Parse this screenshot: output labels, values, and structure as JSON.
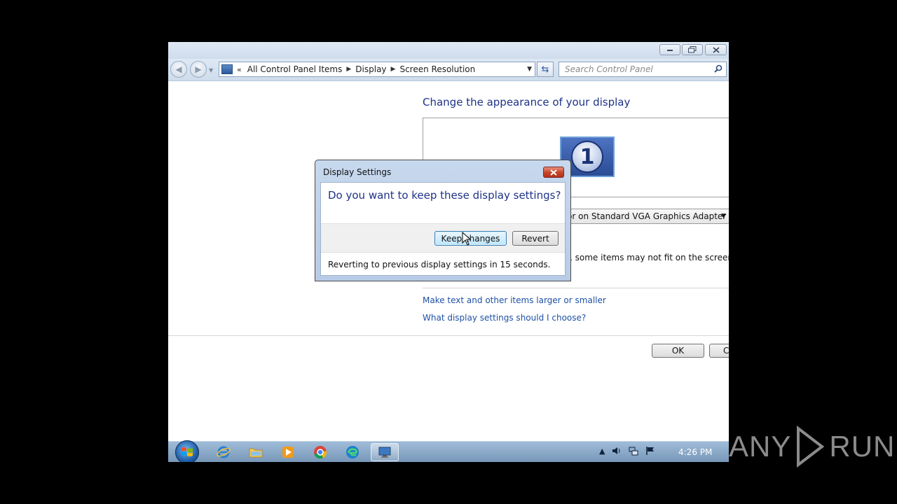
{
  "window": {
    "minimize_icon": "minimize-icon",
    "maximize_icon": "restore-icon",
    "close_icon": "close-icon"
  },
  "address": {
    "overflow": "«",
    "crumbs": [
      "All Control Panel Items",
      "Display",
      "Screen Resolution"
    ],
    "search_placeholder": "Search Control Panel"
  },
  "main": {
    "heading": "Change the appearance of your display",
    "monitor_number": "1",
    "display_select_value": "itor on Standard VGA Graphics Adapter",
    "warning": ", some items may not fit on the screen.",
    "links": [
      "Make text and other items larger or smaller",
      "What display settings should I choose?"
    ],
    "ok_label": "OK",
    "cancel_label": "C"
  },
  "dialog": {
    "title": "Display Settings",
    "question": "Do you want to keep these display settings?",
    "keep_label": "Keep changes",
    "revert_label": "Revert",
    "countdown": "Reverting to previous display settings in 15 seconds."
  },
  "taskbar": {
    "items": [
      "internet-explorer-icon",
      "file-explorer-icon",
      "media-player-icon",
      "chrome-icon",
      "edge-icon",
      "control-panel-display-icon"
    ],
    "active_item": "control-panel-display-icon",
    "clock": "4:26 PM"
  },
  "watermark": {
    "left": "ANY",
    "right": "RUN"
  },
  "colors": {
    "accent": "#1e3287",
    "link": "#1e50a6"
  }
}
